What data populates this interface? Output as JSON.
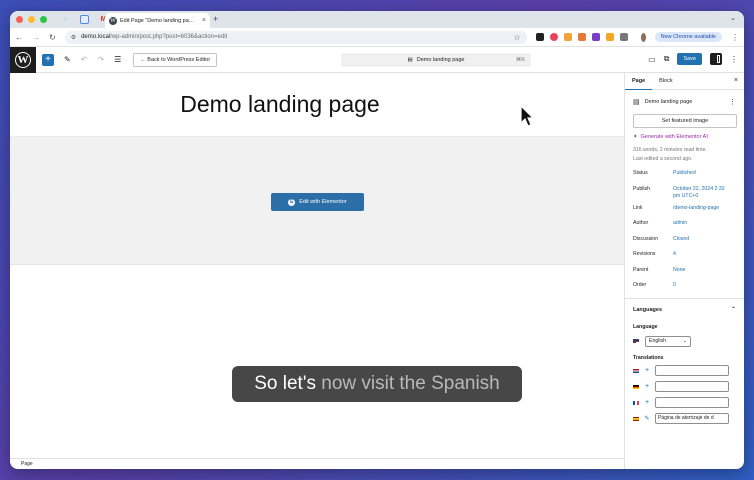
{
  "browser": {
    "tab_title": "Edit Page “Demo landing pa…",
    "url_host": "demo.local",
    "url_path": "/wp-admin/post.php?post=6036&action=edit",
    "chrome_notice": "New Chrome available"
  },
  "toolbar": {
    "back_label": "← Back to WordPress Editor",
    "doc_title": "Demo landing page",
    "shortcut": "⌘K",
    "save_label": "Save"
  },
  "canvas": {
    "page_title": "Demo landing page",
    "elementor_button": "Edit with Elementor"
  },
  "caption": {
    "bright": "So let's",
    "faded": " now visit the Spanish"
  },
  "statusbar": {
    "breadcrumb": "Page"
  },
  "sidebar": {
    "tabs": [
      "Page",
      "Block"
    ],
    "page_name": "Demo landing page",
    "featured_button": "Set featured image",
    "gen_ai": "Generate with Elementor AI",
    "word_count": "316 words, 2 minutes read time.",
    "last_edited": "Last edited a second ago.",
    "props": [
      {
        "key": "Status",
        "value": "Published"
      },
      {
        "key": "Publish",
        "value": "October 22, 2024 2:32 pm UTC+0"
      },
      {
        "key": "Link",
        "value": "/demo-landing-page"
      },
      {
        "key": "Author",
        "value": "admin"
      },
      {
        "key": "Discussion",
        "value": "Closed"
      },
      {
        "key": "Revisions",
        "value": "4"
      },
      {
        "key": "Parent",
        "value": "None"
      },
      {
        "key": "Order",
        "value": "0"
      }
    ],
    "languages": {
      "title": "Languages",
      "language_label": "Language",
      "selected": "English",
      "translations_label": "Translations",
      "spanish_value": "Página de aterrizaje de d"
    }
  },
  "colors": {
    "accent": "#2271b1",
    "ai": "#9b2aa8",
    "elementor": "#2b6ea8"
  }
}
